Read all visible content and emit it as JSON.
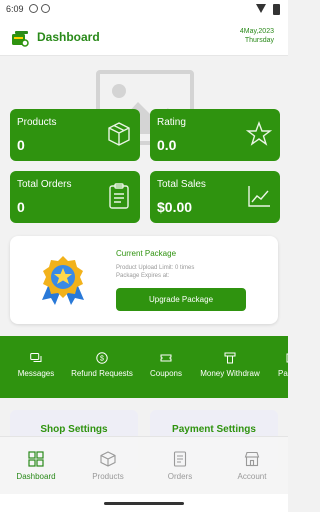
{
  "status_bar": {
    "time": "6:09"
  },
  "header": {
    "title": "Dashboard",
    "date": "4May,2023",
    "day": "Thursday"
  },
  "stats": [
    {
      "label": "Products",
      "value": "0",
      "icon": "box-icon"
    },
    {
      "label": "Rating",
      "value": "0.0",
      "icon": "star-icon"
    },
    {
      "label": "Total Orders",
      "value": "0",
      "icon": "clipboard-icon"
    },
    {
      "label": "Total Sales",
      "value": "$0.00",
      "icon": "chart-line-icon"
    }
  ],
  "package": {
    "title": "Current Package",
    "upload_limit": "Product Upload Limit: 0 times",
    "expires": "Package Expires at:",
    "button": "Upgrade Package",
    "icon": "medal-star-icon"
  },
  "quick_actions": [
    {
      "label": "Messages",
      "icon": "chat-icon"
    },
    {
      "label": "Refund Requests",
      "icon": "dollar-circle-icon"
    },
    {
      "label": "Coupons",
      "icon": "ticket-icon"
    },
    {
      "label": "Money Withdraw",
      "icon": "atm-icon"
    },
    {
      "label": "Pa",
      "icon": "partial-icon"
    }
  ],
  "settings": {
    "shop": "Shop Settings",
    "payment": "Payment Settings"
  },
  "bottom_nav": [
    {
      "label": "Dashboard",
      "icon": "grid-icon"
    },
    {
      "label": "Products",
      "icon": "cube-icon"
    },
    {
      "label": "Orders",
      "icon": "receipt-icon"
    },
    {
      "label": "Account",
      "icon": "store-icon"
    }
  ],
  "colors": {
    "primary": "#2f930f",
    "header_text": "#2a8a1a",
    "background": "#f2f2f2"
  }
}
